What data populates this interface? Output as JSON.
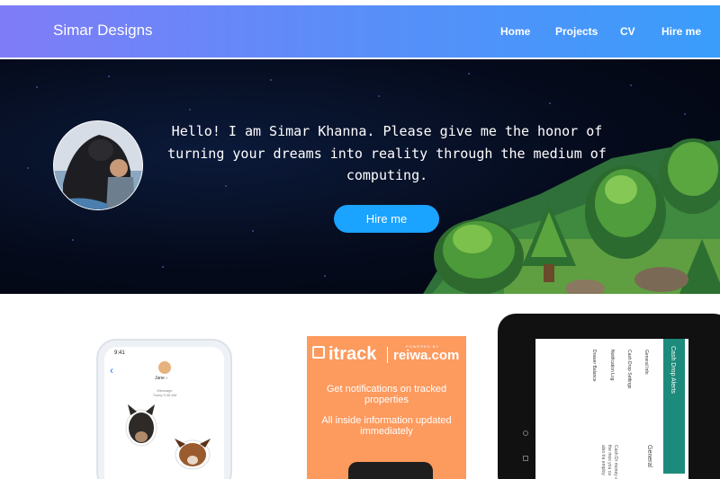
{
  "navbar": {
    "brand": "Simar Designs",
    "links": [
      "Home",
      "Projects",
      "CV",
      "Hire me"
    ]
  },
  "hero": {
    "greeting": "Hello! I am Simar Khanna. Please give me the honor of turning your dreams into reality through the medium of computing.",
    "cta_label": "Hire me"
  },
  "cards": {
    "phone": {
      "time": "9:41",
      "contact": "Jane ›",
      "message_meta": "iMessage\nToday 9:46 AM"
    },
    "itrack": {
      "logo": "itrack",
      "powered_by": "POWERED BY",
      "partner": "reiwa.com",
      "line1": "Get notifications on tracked properties",
      "line2": "All inside information updated immediately"
    },
    "tablet": {
      "app_title": "Cash Drop Alerts",
      "menu": [
        "General Info",
        "Cash Drop Settings",
        "Notification Log",
        "Drawer Balance"
      ],
      "section": "General",
      "body": "Cash Dr money a the mos you ca also tra employ"
    }
  },
  "colors": {
    "nav_gradient_start": "#7f7cf7",
    "nav_gradient_end": "#3a9dfb",
    "cta": "#1aa3ff",
    "itrack_orange": "#fd9a5e",
    "tablet_teal": "#1d8b7b"
  }
}
